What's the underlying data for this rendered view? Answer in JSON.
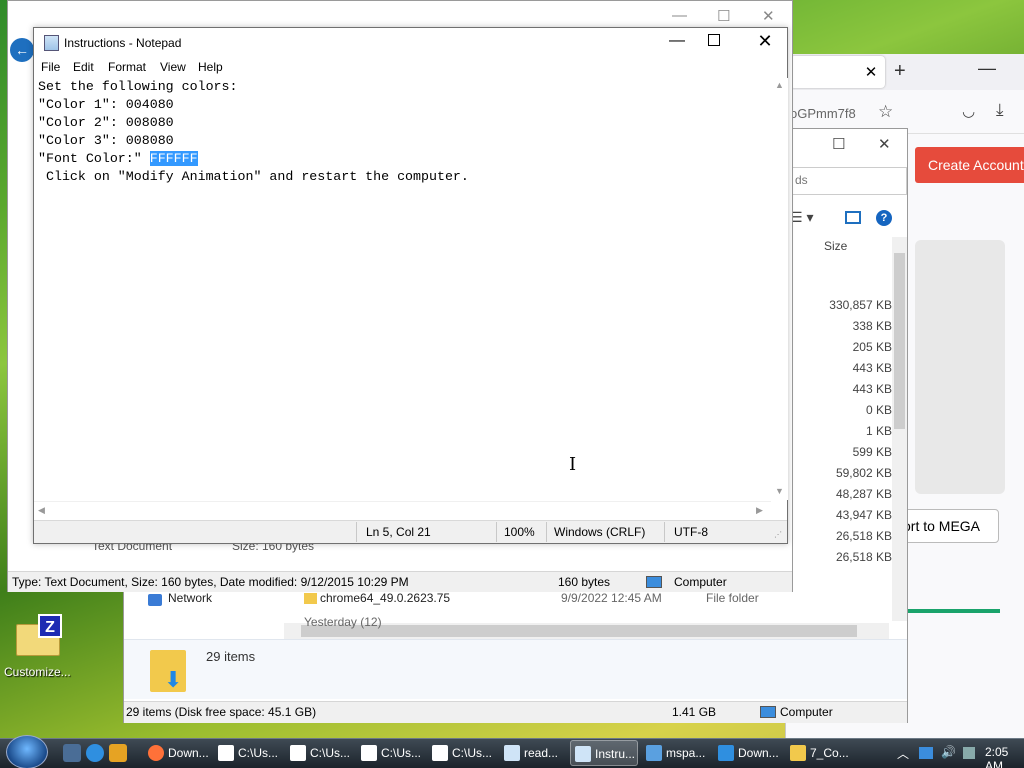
{
  "browser": {
    "url_fragment": "oGPmm7f8",
    "create_account": "Create Account",
    "export_button": "ort to MEGA"
  },
  "explorer": {
    "search_fragment": "ds",
    "size_header": "Size",
    "sizes": [
      "330,857 KB",
      "338 KB",
      "205 KB",
      "443 KB",
      "443 KB",
      "0 KB",
      "1 KB",
      "599 KB",
      "59,802 KB",
      "48,287 KB",
      "43,947 KB",
      "26,518 KB",
      "26,518 KB"
    ],
    "network": "Network",
    "chrome_name": "chrome64_49.0.2623.75",
    "chrome_date": "9/9/2022 12:45 AM",
    "chrome_type": "File folder",
    "yesterday": "Yesterday (12)",
    "items_count": "29 items",
    "status_text": "29 items (Disk free space: 45.1 GB)",
    "status_size": "1.41 GB",
    "status_computer": "Computer"
  },
  "zip": {
    "text_document": "Text Document",
    "size_label": "Size:   160 bytes",
    "status_text": "Type: Text Document, Size: 160 bytes, Date modified: 9/12/2015 10:29 PM",
    "status_bytes": "160 bytes",
    "status_computer": "Computer"
  },
  "notepad": {
    "title": "Instructions - Notepad",
    "menu": {
      "file": "File",
      "edit": "Edit",
      "format": "Format",
      "view": "View",
      "help": "Help"
    },
    "lines": {
      "l1": "Set the following colors:",
      "l2": "\"Color 1\": 004080",
      "l3": "\"Color 2\": 008080",
      "l4": "\"Color 3\": 008080",
      "l5_pre": "\"Font Color:\" ",
      "l5_sel": "FFFFFF",
      "l6": " Click on \"Modify Animation\" and restart the computer."
    },
    "status": {
      "position": "Ln 5, Col 21",
      "zoom": "100%",
      "line_ending": "Windows (CRLF)",
      "encoding": "UTF-8"
    }
  },
  "desktop": {
    "icon_label": "Customize...",
    "icon_letter": "Z"
  },
  "taskbar": {
    "tasks": [
      "Down...",
      "C:\\Us...",
      "C:\\Us...",
      "C:\\Us...",
      "C:\\Us...",
      "read...",
      "Instru...",
      "mspa...",
      "Down...",
      "7_Co..."
    ],
    "clock": "2:05 AM"
  }
}
